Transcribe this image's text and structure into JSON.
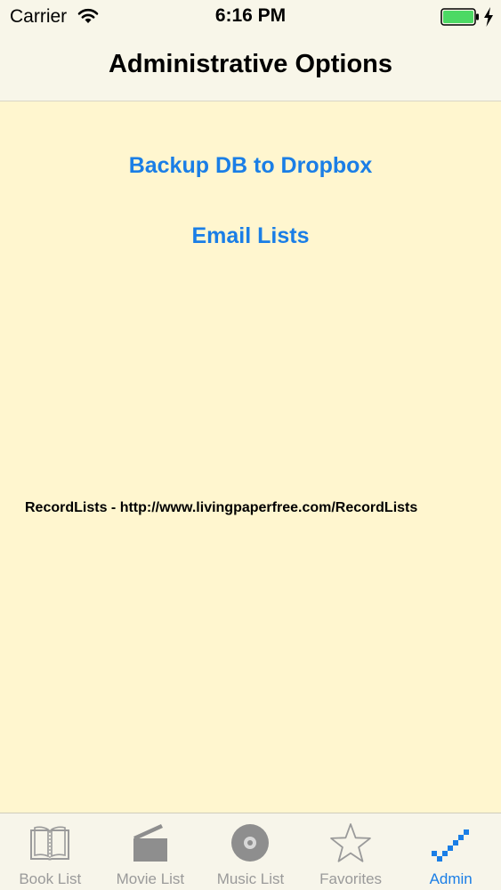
{
  "status_bar": {
    "carrier": "Carrier",
    "time": "6:16 PM",
    "wifi_icon": "wifi-icon",
    "battery_icon": "battery-icon",
    "charging_icon": "charging-bolt-icon"
  },
  "nav": {
    "title": "Administrative Options"
  },
  "actions": {
    "backup_label": "Backup DB to Dropbox",
    "email_label": "Email Lists"
  },
  "footer": {
    "text": "RecordLists - http://www.livingpaperfree.com/RecordLists"
  },
  "tabs": [
    {
      "label": "Book List",
      "icon": "book-icon",
      "active": false
    },
    {
      "label": "Movie List",
      "icon": "clapperboard-icon",
      "active": false
    },
    {
      "label": "Music List",
      "icon": "disc-icon",
      "active": false
    },
    {
      "label": "Favorites",
      "icon": "star-icon",
      "active": false
    },
    {
      "label": "Admin",
      "icon": "admin-checkmark-icon",
      "active": true
    }
  ],
  "colors": {
    "accent": "#1A7EE6",
    "background": "#FFF6CF",
    "inactive_tab": "#9A9A9A",
    "battery_fill": "#4CD964"
  }
}
